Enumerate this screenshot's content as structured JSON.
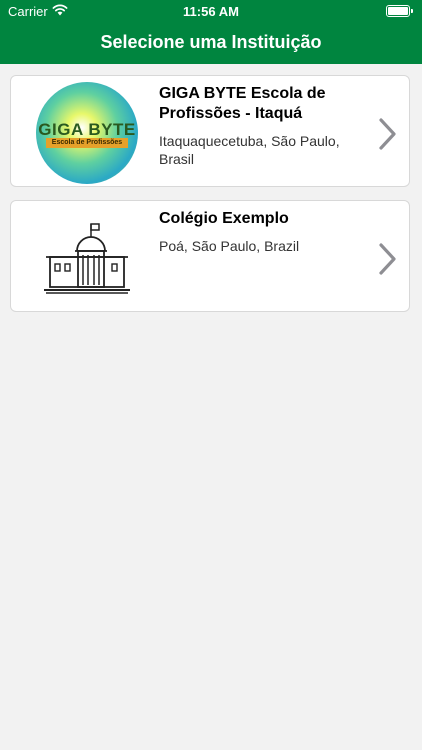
{
  "status_bar": {
    "carrier": "Carrier",
    "time": "11:56 AM"
  },
  "nav": {
    "title": "Selecione uma Instituição"
  },
  "institutions": [
    {
      "name": "GIGA BYTE Escola de Profissões - Itaquá",
      "location": "Itaquaquecetuba, São Paulo, Brasil",
      "logo": {
        "title": "GIGA BYTE",
        "subtitle": "Escola de Profissões"
      }
    },
    {
      "name": "Colégio Exemplo",
      "location": "Poá, São Paulo, Brazil",
      "logo_icon": "building-icon"
    }
  ],
  "colors": {
    "nav_background": "#00853f",
    "page_background": "#f2f2f2",
    "chevron": "#8e8e93"
  },
  "icons": {
    "wifi": "wifi-icon",
    "battery": "battery-icon",
    "chevron": "chevron-right-icon"
  }
}
